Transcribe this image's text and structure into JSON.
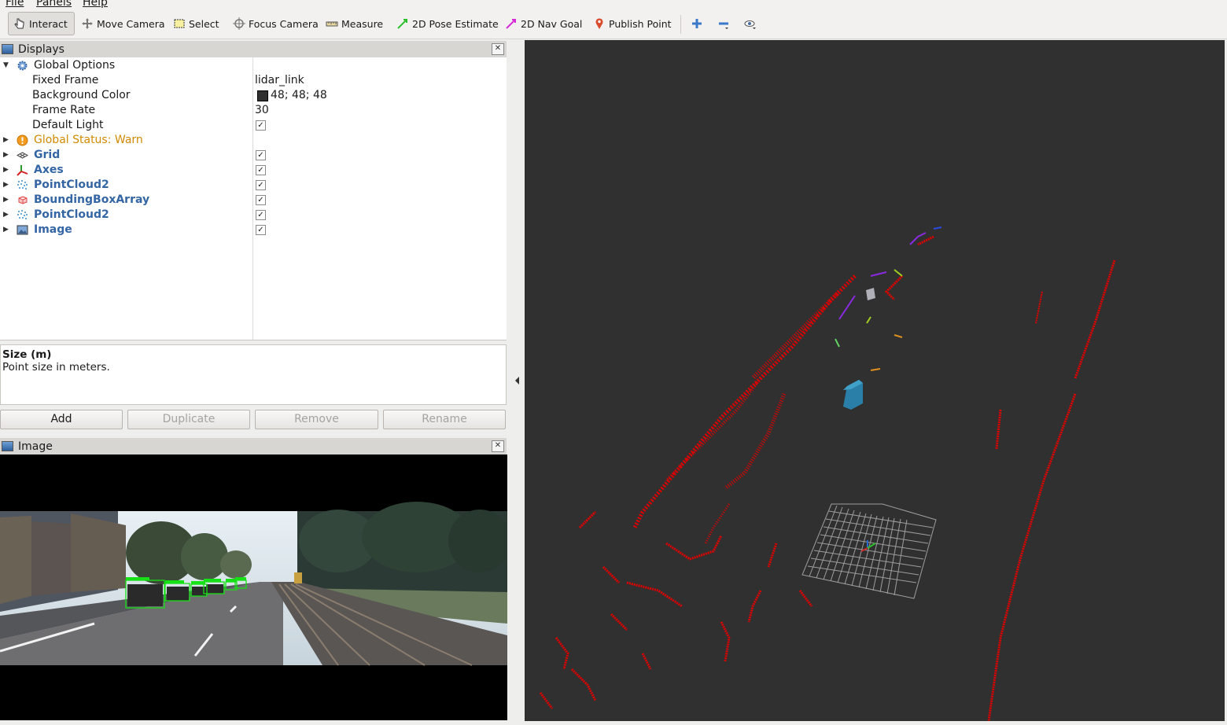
{
  "menu": {
    "items": [
      "File",
      "Panels",
      "Help"
    ]
  },
  "toolbar": {
    "interact": "Interact",
    "move_camera": "Move Camera",
    "select": "Select",
    "focus_camera": "Focus Camera",
    "measure": "Measure",
    "pose_estimate": "2D Pose Estimate",
    "nav_goal": "2D Nav Goal",
    "publish_point": "Publish Point"
  },
  "displays": {
    "title": "Displays",
    "global_options": "Global Options",
    "props": [
      {
        "name": "Fixed Frame",
        "value": "lidar_link"
      },
      {
        "name": "Background Color",
        "value": "48; 48; 48"
      },
      {
        "name": "Frame Rate",
        "value": "30"
      },
      {
        "name": "Default Light",
        "value": ""
      }
    ],
    "global_status": "Global Status: Warn",
    "items": [
      {
        "label": "Grid",
        "checked": true
      },
      {
        "label": "Axes",
        "checked": true
      },
      {
        "label": "PointCloud2",
        "checked": true
      },
      {
        "label": "BoundingBoxArray",
        "checked": true
      },
      {
        "label": "PointCloud2",
        "checked": true
      },
      {
        "label": "Image",
        "checked": true
      }
    ]
  },
  "description": {
    "title": "Size (m)",
    "text": "Point size in meters."
  },
  "buttons": {
    "add": "Add",
    "duplicate": "Duplicate",
    "remove": "Remove",
    "rename": "Rename"
  },
  "image_panel": {
    "title": "Image"
  },
  "colors": {
    "background": "#303030",
    "points": "#e00000",
    "grid": "#a0a0a0",
    "status_warn": "#d08a00",
    "link": "#3465a4"
  }
}
